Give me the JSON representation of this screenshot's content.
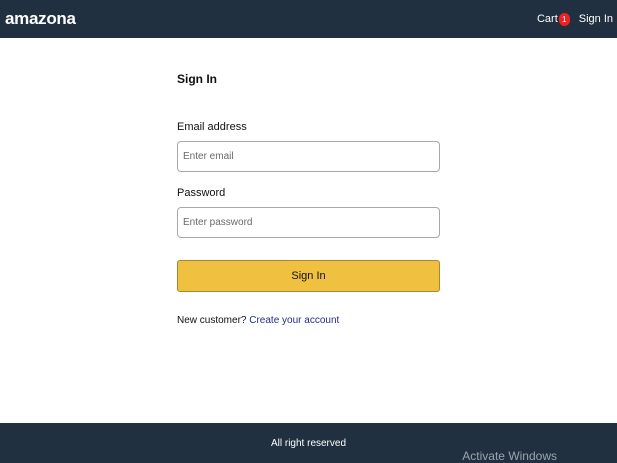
{
  "header": {
    "brand": "amazona",
    "cart_label": "Cart",
    "cart_count": "1",
    "signin_label": "Sign In"
  },
  "form": {
    "title": "Sign In",
    "email_label": "Email address",
    "email_placeholder": "Enter email",
    "password_label": "Password",
    "password_placeholder": "Enter password",
    "submit_label": "Sign In",
    "new_customer_text": "New customer?",
    "create_account_label": "Create your account"
  },
  "footer": {
    "text": "All right reserved"
  },
  "watermark": {
    "text": "Activate Windows"
  },
  "colors": {
    "header_bg": "#203040",
    "button_bg": "#f0c040",
    "badge_bg": "#f02020",
    "link": "#203080"
  }
}
